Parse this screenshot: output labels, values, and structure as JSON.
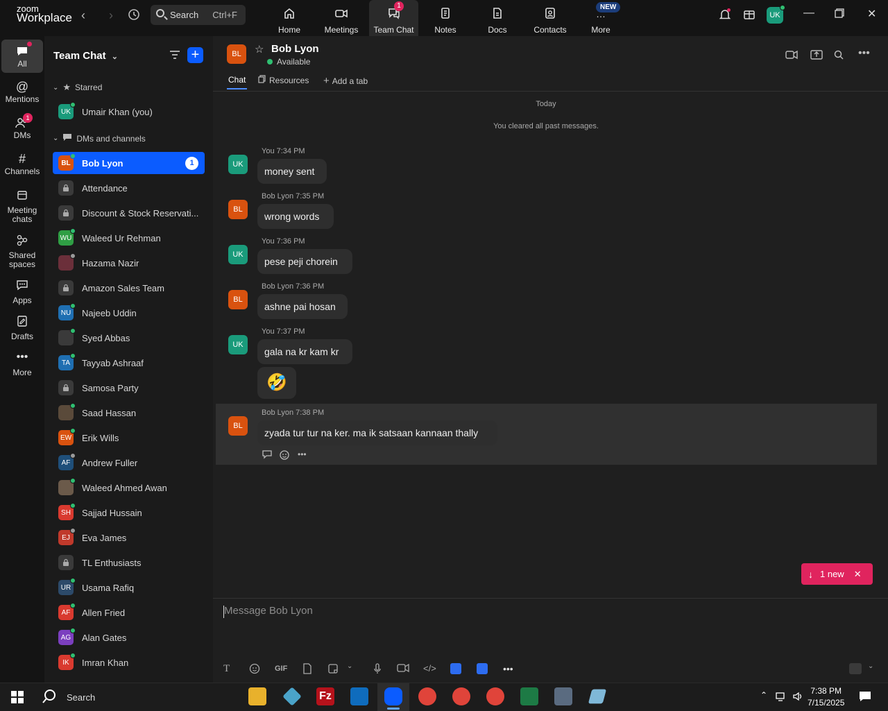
{
  "app": {
    "brand_line1": "zoom",
    "brand_line2": "Workplace"
  },
  "search": {
    "label": "Search",
    "shortcut": "Ctrl+F"
  },
  "top_tabs": [
    {
      "label": "Home",
      "icon": "home-icon"
    },
    {
      "label": "Meetings",
      "icon": "video-camera-icon"
    },
    {
      "label": "Team Chat",
      "icon": "chat-bubble-icon",
      "badge": "1",
      "active": true
    },
    {
      "label": "Notes",
      "icon": "notes-icon"
    },
    {
      "label": "Docs",
      "icon": "docs-icon"
    },
    {
      "label": "Contacts",
      "icon": "contacts-icon"
    },
    {
      "label": "More",
      "icon": "more-dots-icon",
      "flag": "NEW"
    }
  ],
  "user_avatar": "UK",
  "rail": [
    {
      "label": "All",
      "icon": "chat-icon",
      "active": true
    },
    {
      "label": "Mentions",
      "icon": "at-icon"
    },
    {
      "label": "DMs",
      "icon": "people-icon",
      "badge": "1"
    },
    {
      "label": "Channels",
      "icon": "hash-icon"
    },
    {
      "label": "Meeting chats",
      "icon": "calendar-icon"
    },
    {
      "label": "Shared spaces",
      "icon": "shared-spaces-icon"
    },
    {
      "label": "Apps",
      "icon": "apps-icon"
    },
    {
      "label": "Drafts",
      "icon": "drafts-icon"
    },
    {
      "label": "More",
      "icon": "more-icon"
    }
  ],
  "sidebar": {
    "title": "Team Chat",
    "starred_label": "Starred",
    "starred": [
      {
        "initials": "UK",
        "name": "Umair Khan (you)",
        "color": "#1a9b7b",
        "presence": "#2fbf71"
      }
    ],
    "dms_label": "DMs and channels",
    "items": [
      {
        "initials": "BL",
        "name": "Bob Lyon",
        "color": "#d9520f",
        "presence": "#2fbf71",
        "count": "1",
        "selected": true
      },
      {
        "lock": true,
        "name": "Attendance"
      },
      {
        "lock": true,
        "name": "Discount & Stock Reservati..."
      },
      {
        "initials": "WU",
        "name": "Waleed Ur Rehman",
        "color": "#2f9e44",
        "presence": "#2fbf71"
      },
      {
        "photo": true,
        "name": "Hazama Nazir",
        "color": "#6b2f3a",
        "presence": "#9a9a9a"
      },
      {
        "lock": true,
        "name": "Amazon Sales Team"
      },
      {
        "initials": "NU",
        "name": "Najeeb Uddin",
        "color": "#1f6fb2",
        "presence": "#2fbf71"
      },
      {
        "photo": true,
        "name": "Syed Abbas",
        "color": "#3a3a3a",
        "presence": "#2fbf71"
      },
      {
        "initials": "TA",
        "name": "Tayyab Ashraaf",
        "color": "#1f6fb2",
        "presence": "#2fbf71"
      },
      {
        "lock": true,
        "name": "Samosa Party"
      },
      {
        "photo": true,
        "name": "Saad Hassan",
        "color": "#5a4a3a",
        "presence": "#2fbf71"
      },
      {
        "initials": "EW",
        "name": "Erik Wills",
        "color": "#d9520f",
        "presence": "#2fbf71"
      },
      {
        "initials": "AF",
        "name": "Andrew Fuller",
        "color": "#1f4f7a",
        "presence": "#9a9a9a"
      },
      {
        "photo": true,
        "name": "Waleed Ahmed Awan",
        "color": "#6b5a4a",
        "presence": "#2fbf71"
      },
      {
        "initials": "SH",
        "name": "Sajjad Hussain",
        "color": "#d93a2f",
        "presence": "#2fbf71"
      },
      {
        "initials": "EJ",
        "name": "Eva James",
        "color": "#c0392b",
        "presence": "#9a9a9a"
      },
      {
        "lock": true,
        "name": "TL Enthusiasts"
      },
      {
        "initials": "UR",
        "name": "Usama Rafiq",
        "color": "#2c4a6a",
        "presence": "#2fbf71"
      },
      {
        "initials": "AF",
        "name": "Allen Fried",
        "color": "#d93a2f",
        "presence": "#2fbf71"
      },
      {
        "initials": "AG",
        "name": "Alan Gates",
        "color": "#7b3fbf",
        "presence": "#2fbf71"
      },
      {
        "initials": "IK",
        "name": "Imran Khan",
        "color": "#d93a2f",
        "presence": "#2fbf71"
      }
    ]
  },
  "chat": {
    "contact_initials": "BL",
    "contact_name": "Bob Lyon",
    "status": "Available",
    "tabs": [
      "Chat",
      "Resources",
      "Add a tab"
    ],
    "day_label": "Today",
    "cleared_note": "You cleared all past messages.",
    "messages": [
      {
        "author": "You",
        "time": "7:34 PM",
        "initials": "UK",
        "color": "#1a9b7b",
        "text": "money sent"
      },
      {
        "author": "Bob Lyon",
        "time": "7:35 PM",
        "initials": "BL",
        "color": "#d9520f",
        "text": "wrong words"
      },
      {
        "author": "You",
        "time": "7:36 PM",
        "initials": "UK",
        "color": "#1a9b7b",
        "text": "pese peji chorein"
      },
      {
        "author": "Bob Lyon",
        "time": "7:36 PM",
        "initials": "BL",
        "color": "#d9520f",
        "text": "ashne pai hosan"
      },
      {
        "author": "You",
        "time": "7:37 PM",
        "initials": "UK",
        "color": "#1a9b7b",
        "text": "gala na kr kam kr"
      },
      {
        "author": "Bob Lyon",
        "time": "7:38 PM",
        "initials": "BL",
        "color": "#d9520f",
        "text": "zyada tur tur na ker. ma ik satsaan kannaan thally"
      }
    ],
    "emoji": "🤣",
    "new_pill": "1 new",
    "composer_placeholder": "Message Bob Lyon",
    "gif_label": "GIF"
  },
  "taskbar": {
    "search_label": "Search",
    "time": "7:38 PM",
    "date": "7/15/2025"
  }
}
